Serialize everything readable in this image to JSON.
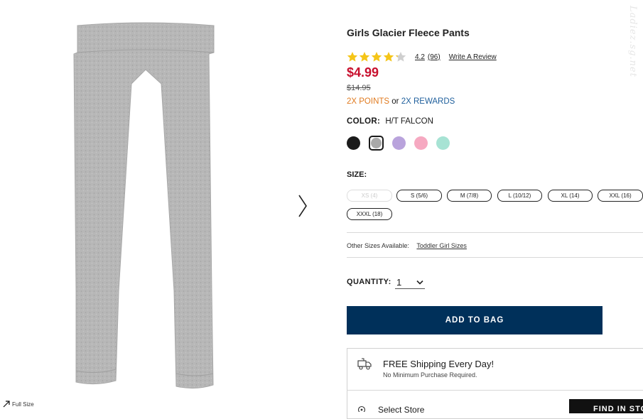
{
  "product": {
    "title": "Girls Glacier Fleece Pants",
    "rating": {
      "stars": 4.2,
      "value": "4.2",
      "count": "(96)",
      "write_review": "Write A Review"
    },
    "price": {
      "sale": "$4.99",
      "original": "$14.95"
    },
    "rewards": {
      "points": "2X POINTS",
      "or": "or",
      "rewards": "2X REWARDS"
    },
    "color": {
      "label": "COLOR:",
      "value": "H/T FALCON",
      "swatches": [
        "#1b1b1b",
        "#a9a9a9",
        "#b9a3dc",
        "#f6a9c1",
        "#a7e3d4"
      ],
      "selected_index": 1
    },
    "size": {
      "label": "SIZE:",
      "options": [
        {
          "label": "XS (4)",
          "available": false
        },
        {
          "label": "S (5/6)",
          "available": true
        },
        {
          "label": "M (7/8)",
          "available": true
        },
        {
          "label": "L (10/12)",
          "available": true
        },
        {
          "label": "XL (14)",
          "available": true
        },
        {
          "label": "XXL (16)",
          "available": true
        },
        {
          "label": "XXXL (18)",
          "available": true
        }
      ]
    },
    "other_sizes": {
      "label": "Other Sizes Available:",
      "link": "Toddler Girl Sizes"
    },
    "quantity": {
      "label": "QUANTITY:",
      "value": "1"
    },
    "add_to_bag": "ADD TO BAG",
    "shipping": {
      "title": "FREE Shipping Every Day!",
      "subtitle": "No Minimum Purchase Required."
    },
    "store": {
      "label": "Select Store",
      "button": "FIND IN STORE"
    }
  },
  "image": {
    "full_size_label": "Full Size"
  },
  "watermark": "Ladiez.sg.net",
  "colors": {
    "price_red": "#c8102e",
    "points_orange": "#e07a1f",
    "rewards_blue": "#1f5f9c",
    "bag_navy": "#00305a",
    "star_gold": "#f5c518"
  },
  "icons": [
    "next-arrow-icon",
    "expand-icon",
    "star-icon",
    "truck-icon",
    "location-pin-icon",
    "chevron-down-icon"
  ]
}
